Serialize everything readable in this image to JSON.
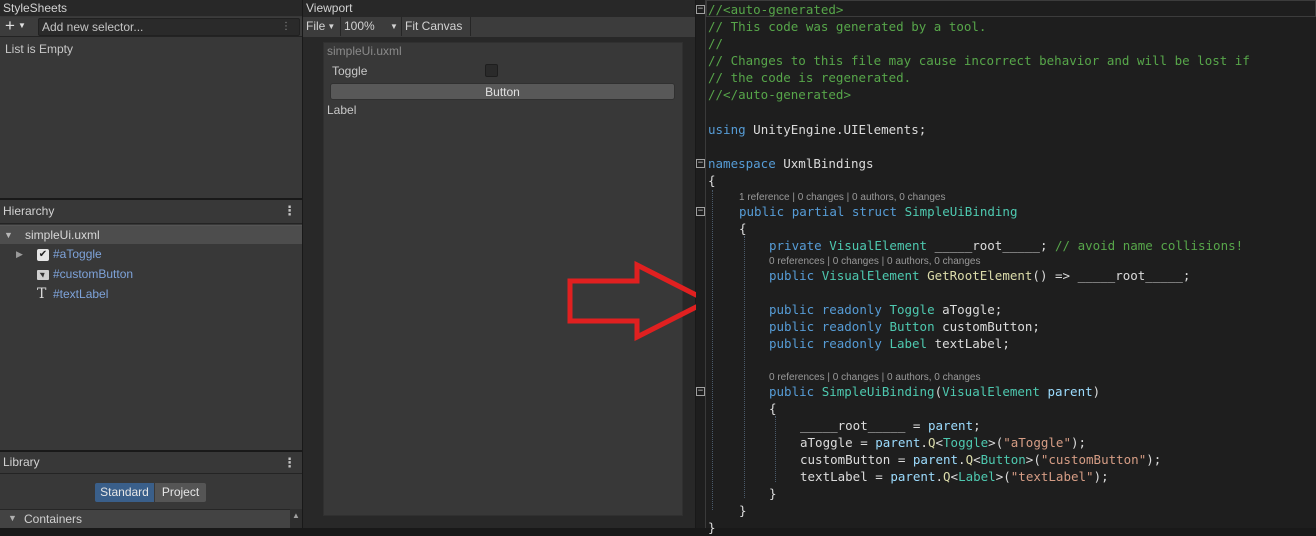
{
  "stylesheets": {
    "title": "StyleSheets",
    "add_icon": "+",
    "selector_placeholder": "Add new selector...",
    "empty_text": "List is Empty"
  },
  "hierarchy": {
    "title": "Hierarchy",
    "root": "simpleUi.uxml",
    "items": [
      {
        "label": "#aToggle",
        "icon": "checkbox-icon"
      },
      {
        "label": "#customButton",
        "icon": "button-icon"
      },
      {
        "label": "#textLabel",
        "icon": "text-icon",
        "glyph": "T"
      }
    ]
  },
  "library": {
    "title": "Library",
    "tabs": [
      "Standard",
      "Project"
    ],
    "active_tab": "Standard",
    "section": "Containers"
  },
  "viewport": {
    "title": "Viewport",
    "file_menu": "File",
    "zoom": "100%",
    "fit_canvas": "Fit Canvas",
    "document_name": "simpleUi.uxml",
    "toggle_label": "Toggle",
    "button_label": "Button",
    "label_text": "Label"
  },
  "colors": {
    "accent_selected": "#3a5f8a",
    "arrow": "#e02020",
    "link_text": "#7ea3da"
  },
  "code": {
    "lines": [
      "//<auto-generated>",
      "// This code was generated by a tool.",
      "//",
      "// Changes to this file may cause incorrect behavior and will be lost if",
      "// the code is regenerated.",
      "//</auto-generated>",
      "using UnityEngine.UIElements;",
      "namespace UxmlBindings",
      "{",
      "public partial struct SimpleUiBinding",
      "{",
      "private VisualElement _____root_____; // avoid name collisions!",
      "public VisualElement GetRootElement() => _____root_____;",
      "public readonly Toggle aToggle;",
      "public readonly Button customButton;",
      "public readonly Label textLabel;",
      "public SimpleUiBinding(VisualElement parent)",
      "{",
      "_____root_____ = parent;",
      "aToggle = parent.Q<Toggle>(\"aToggle\");",
      "customButton = parent.Q<Button>(\"customButton\");",
      "textLabel = parent.Q<Label>(\"textLabel\");",
      "}",
      "}",
      "}"
    ],
    "lens_struct": "1 reference | 0 changes | 0 authors, 0 changes",
    "lens_method": "0 references | 0 changes | 0 authors, 0 changes",
    "lens_ctor": "0 references | 0 changes | 0 authors, 0 changes"
  }
}
